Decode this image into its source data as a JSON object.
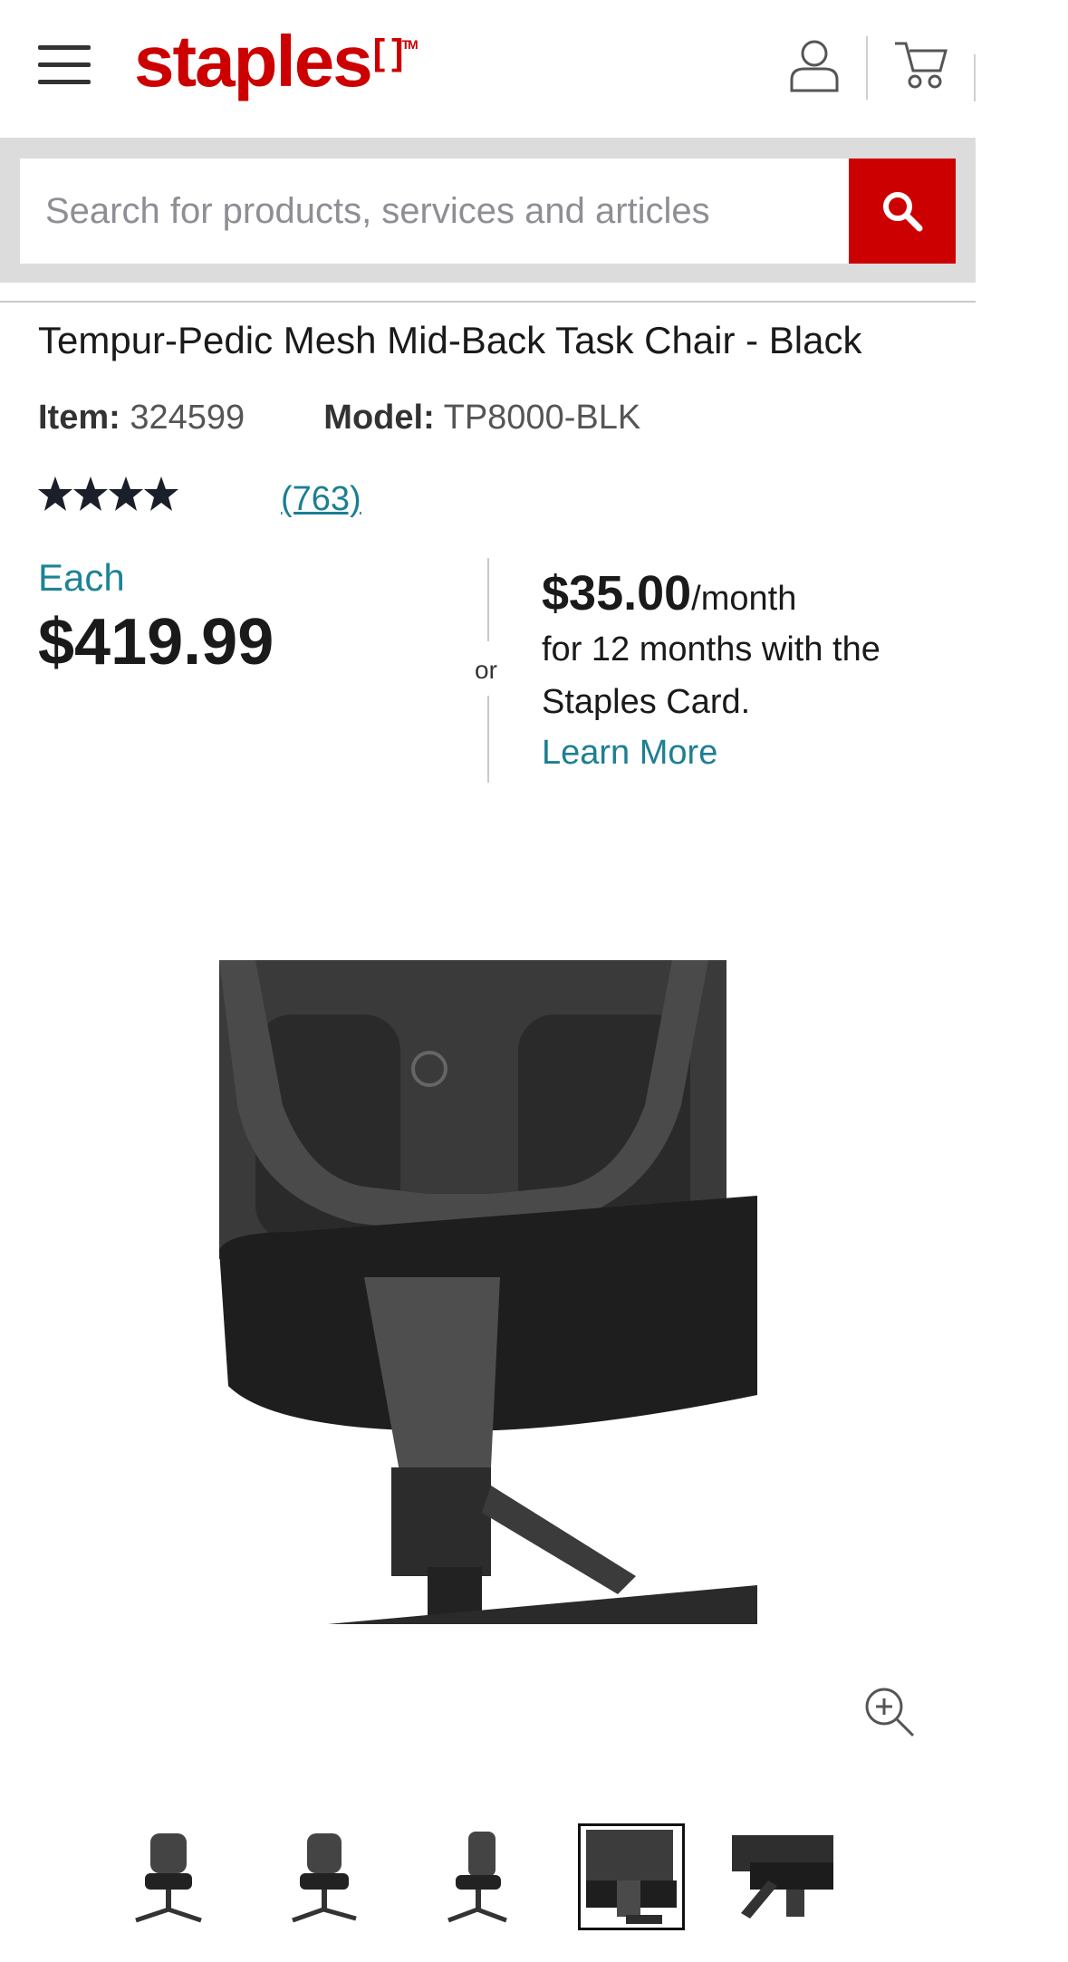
{
  "header": {
    "logo_text": "staples",
    "logo_mark": "[ ]",
    "logo_tm": "TM",
    "brand_color": "#cc0000",
    "icons": [
      "menu-icon",
      "account-icon",
      "cart-icon"
    ]
  },
  "search": {
    "placeholder": "Search for products, services and articles",
    "button_icon": "search-icon"
  },
  "product": {
    "title": "Tempur-Pedic Mesh Mid-Back Task Chair - Black",
    "item_label": "Item:",
    "item_value": "324599",
    "model_label": "Model:",
    "model_value": "TP8000-BLK",
    "rating_stars": 4,
    "reviews": "(763)"
  },
  "pricing": {
    "each_label": "Each",
    "price": "$419.99",
    "or": "or",
    "monthly_amount": "$35.00",
    "monthly_suffix": "/month",
    "terms_line1": "for 12 months with the",
    "terms_line2": "Staples Card.",
    "learn_more": "Learn More",
    "accent_color": "#1d8495"
  },
  "gallery": {
    "thumbnails": [
      "chair-front",
      "chair-angle",
      "chair-side",
      "chair-back",
      "chair-mechanism"
    ],
    "selected_index": 3,
    "zoom_icon": "zoom-in-icon"
  }
}
